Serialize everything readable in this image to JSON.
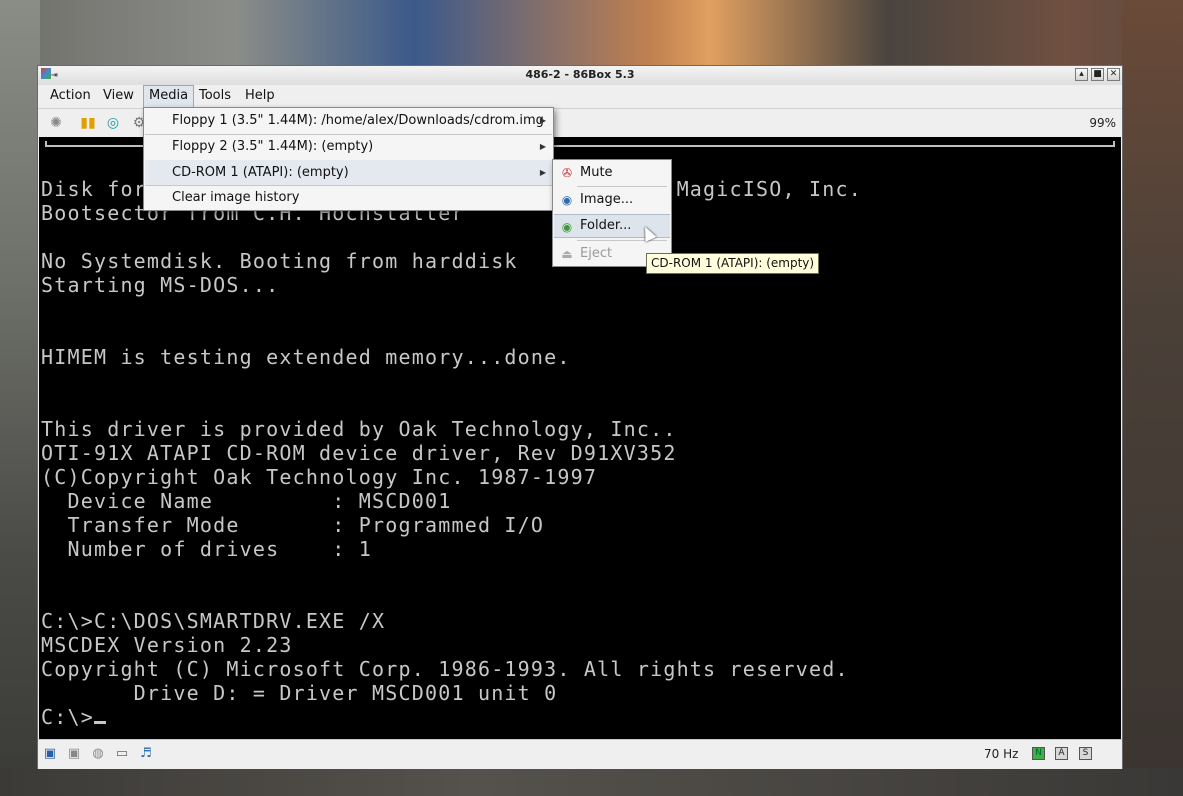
{
  "window": {
    "title": "486-2 - 86Box 5.3",
    "buttons": [
      "minimize",
      "maximize",
      "close"
    ]
  },
  "menubar": {
    "items": [
      {
        "label": "Action"
      },
      {
        "label": "View"
      },
      {
        "label": "Media"
      },
      {
        "label": "Tools"
      },
      {
        "label": "Help"
      }
    ],
    "active": "Media"
  },
  "toolbar": {
    "icons": [
      "hard-reset-icon",
      "pause-icon",
      "ctrl-alt-del-icon",
      "settings-icon"
    ],
    "zoom": "99%"
  },
  "media_menu": {
    "items": [
      {
        "label": "Floppy 1 (3.5\" 1.44M): /home/alex/Downloads/cdrom.img",
        "has_submenu": true
      },
      {
        "label": "Floppy 2 (3.5\" 1.44M): (empty)",
        "has_submenu": true
      },
      {
        "label": "CD-ROM 1 (ATAPI): (empty)",
        "has_submenu": true
      },
      {
        "label": "Clear image history",
        "has_submenu": false
      }
    ]
  },
  "cdrom_submenu": {
    "items": [
      {
        "label": "Mute",
        "icon": "mute-icon"
      },
      {
        "label": "Image...",
        "icon": "image-icon"
      },
      {
        "label": "Folder...",
        "icon": "folder-icon"
      },
      {
        "label": "Eject",
        "icon": "eject-icon",
        "disabled": true
      }
    ]
  },
  "tooltip": "CD-ROM 1 (ATAPI): (empty)",
  "console": {
    "lines": [
      "Disk formatted with WinImage 8.50 (c) 1993-2018 MagicISO, Inc.",
      "Bootsector from C.H. Hochstätter",
      "",
      "No Systemdisk. Booting from harddisk",
      "Starting MS-DOS...",
      "",
      "",
      "HIMEM is testing extended memory...done.",
      "",
      "",
      "This driver is provided by Oak Technology, Inc..",
      "OTI-91X ATAPI CD-ROM device driver, Rev D91XV352",
      "(C)Copyright Oak Technology Inc. 1987-1997",
      "  Device Name         : MSCD001",
      "  Transfer Mode       : Programmed I/O",
      "  Number of drives    : 1",
      "",
      "",
      "C:\\>C:\\DOS\\SMARTDRV.EXE /X",
      "MSCDEX Version 2.23",
      "Copyright (C) Microsoft Corp. 1986-1993. All rights reserved.",
      "       Drive D: = Driver MSCD001 unit 0",
      "C:\\>"
    ]
  },
  "statusbar": {
    "icons": [
      "floppy1-icon",
      "floppy2-icon",
      "cdrom-icon",
      "hdd-icon",
      "sound-icon"
    ],
    "refresh_rate": "70 Hz",
    "leds": [
      "N",
      "A",
      "S"
    ]
  }
}
